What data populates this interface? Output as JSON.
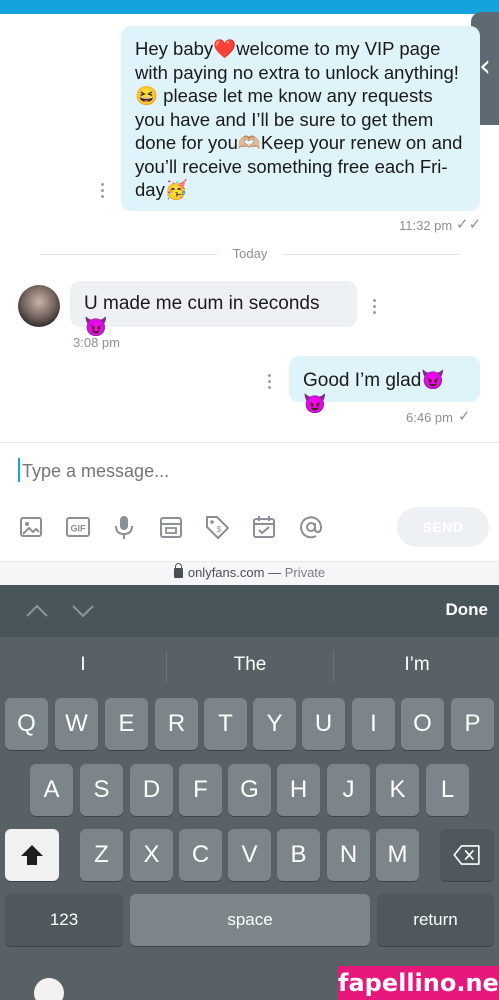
{
  "conversation": {
    "messages": [
      {
        "lines": [
          "Hey baby❤️welcome to my VIP page",
          "with paying no extra to unlock anything!",
          "😆 please let me know any requests",
          "you have and I’ll be sure to get them",
          "done for you🫶🏼Keep your renew on and",
          "you’ll receive something free each Fri-",
          "day🥳"
        ],
        "time": "11:32 pm"
      },
      {
        "text": "U made me cum in seconds 😈",
        "time": "3:08 pm"
      },
      {
        "text": "Good I’m glad😈😈",
        "time": "6:46 pm"
      }
    ],
    "day_separator": "Today"
  },
  "composer": {
    "placeholder": "Type a message...",
    "send_label": "SEND",
    "tools": [
      "image-icon",
      "gif-icon",
      "microphone-icon",
      "vault-icon",
      "price-tag-icon",
      "calendar-icon",
      "mention-icon"
    ]
  },
  "browser": {
    "domain": "onlyfans.com",
    "separator": "—",
    "privacy": "Private"
  },
  "keyboard": {
    "done_label": "Done",
    "suggestions": [
      "I",
      "The",
      "I’m"
    ],
    "row1": [
      "Q",
      "W",
      "E",
      "R",
      "T",
      "Y",
      "U",
      "I",
      "O",
      "P"
    ],
    "row2": [
      "A",
      "S",
      "D",
      "F",
      "G",
      "H",
      "J",
      "K",
      "L"
    ],
    "row3": [
      "Z",
      "X",
      "C",
      "V",
      "B",
      "N",
      "M"
    ],
    "numbers_label": "123",
    "space_label": "space",
    "return_label": "return"
  },
  "watermark": "fapellino.net",
  "colors": {
    "accent": "#15a3e0",
    "outgoing_bubble": "#dff3fb",
    "incoming_bubble": "#eef1f3",
    "keyboard": "#576166"
  }
}
